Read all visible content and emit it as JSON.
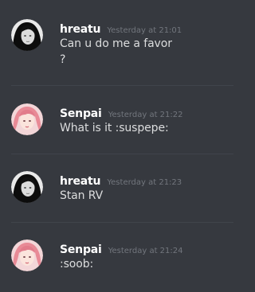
{
  "messages": [
    {
      "author": "hreatu",
      "timestamp": "Yesterday at 21:01",
      "lines": [
        "Can u do me a favor",
        "?"
      ],
      "avatar": "bw-photo-avatar-icon"
    },
    {
      "author": "Senpai",
      "timestamp": "Yesterday at 21:22",
      "lines": [
        "What is it :suspepe:"
      ],
      "avatar": "pink-hair-avatar-icon"
    },
    {
      "author": "hreatu",
      "timestamp": "Yesterday at 21:23",
      "lines": [
        "Stan RV"
      ],
      "avatar": "bw-photo-avatar-icon"
    },
    {
      "author": "Senpai",
      "timestamp": "Yesterday at 21:24",
      "lines": [
        ":soob:"
      ],
      "avatar": "pink-hair-avatar-icon"
    }
  ],
  "colors": {
    "background": "#36393f",
    "username": "#ffffff",
    "timestamp": "#72767d",
    "message_text": "#dcddde",
    "divider": "#40444b"
  }
}
